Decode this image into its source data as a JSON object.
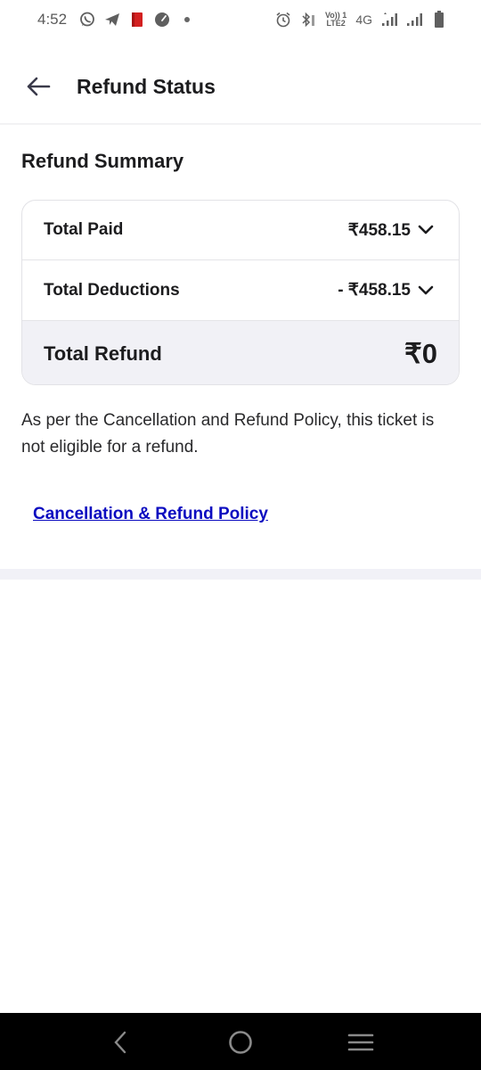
{
  "status_bar": {
    "time": "4:52",
    "left_icons": [
      "whatsapp-icon",
      "telegram-icon",
      "red-app-icon",
      "speedometer-icon",
      "notification-dot-icon"
    ],
    "right_icons": [
      "alarm-icon",
      "bluetooth-icon",
      "volte-lte2-icon",
      "4g-icon",
      "signal-sim1-icon",
      "signal-sim2-icon",
      "battery-icon"
    ],
    "volte_top": "Vo)) 1",
    "volte_bottom": "LTE2",
    "network": "4G"
  },
  "header": {
    "back_icon": "arrow-left-icon",
    "title": "Refund Status"
  },
  "summary": {
    "title": "Refund Summary",
    "rows": [
      {
        "label": "Total Paid",
        "value": "₹458.15",
        "expandable": true
      },
      {
        "label": "Total Deductions",
        "value": "- ₹458.15",
        "expandable": true
      }
    ],
    "total": {
      "label": "Total Refund",
      "value": "₹0"
    }
  },
  "info": {
    "message": "As per the Cancellation and Refund Policy, this ticket is not eligible for a refund."
  },
  "policy_link": {
    "label": "Cancellation & Refund Policy"
  },
  "colors": {
    "link": "#0b0bc0",
    "total_row_bg": "#f1f1f6",
    "text": "#1c1c1e",
    "nav_bar_bg": "#000000"
  },
  "nav_bar": {
    "buttons": [
      "back-icon",
      "home-icon",
      "recents-icon"
    ]
  }
}
